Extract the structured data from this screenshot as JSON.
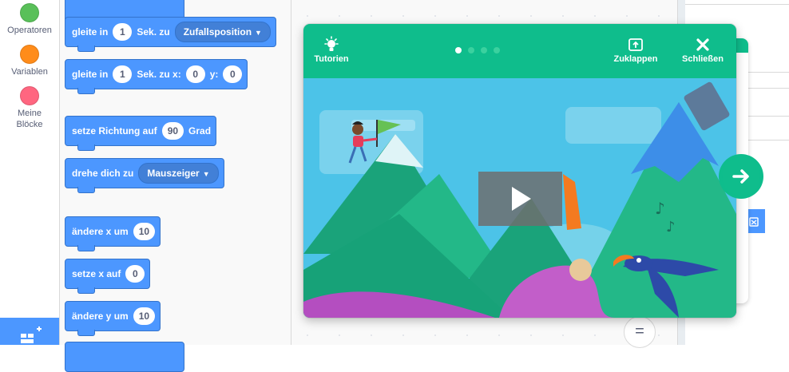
{
  "categories": [
    {
      "label": "Operatoren",
      "color": "#59c059"
    },
    {
      "label": "Variablen",
      "color": "#ff8c1a"
    },
    {
      "label": "Meine\nBlöcke",
      "color": "#ff6680"
    }
  ],
  "blocks": {
    "glide_random": {
      "pre": "gleite in",
      "secs": "1",
      "mid": "Sek. zu",
      "target": "Zufallsposition"
    },
    "glide_xy": {
      "pre": "gleite in",
      "secs": "1",
      "mid": "Sek. zu x:",
      "x": "0",
      "ylabel": "y:",
      "y": "0"
    },
    "point_dir": {
      "pre": "setze Richtung auf",
      "value": "90",
      "post": "Grad"
    },
    "point_towards": {
      "pre": "drehe dich zu",
      "target": "Mauszeiger"
    },
    "change_x": {
      "pre": "ändere x um",
      "value": "10"
    },
    "set_x": {
      "pre": "setze x auf",
      "value": "0"
    },
    "change_y": {
      "pre": "ändere y um",
      "value": "10"
    }
  },
  "tutorial": {
    "tutorials_label": "Tutorien",
    "collapse_label": "Zuklappen",
    "close_label": "Schließen",
    "steps_total": 4,
    "step_current": 1
  },
  "zoom_label": "=",
  "colors": {
    "motion_blue": "#4c97ff",
    "tutorial_green": "#0fbd8c"
  },
  "icons": [
    "lightbulb-icon",
    "collapse-icon",
    "close-icon",
    "play-icon",
    "arrow-right-icon",
    "add-extension-icon",
    "trash-icon"
  ]
}
